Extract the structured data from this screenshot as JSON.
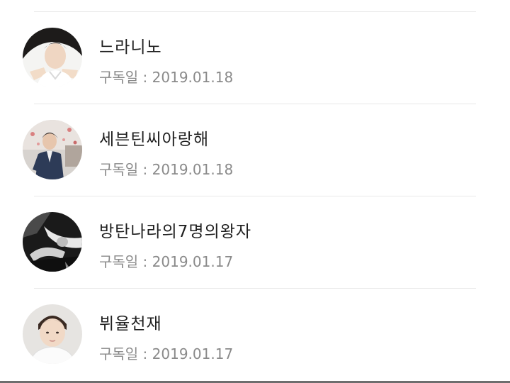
{
  "subscriptions": [
    {
      "name": "느라니노",
      "date_label": "구독일 : 2019.01.18",
      "avatar_icon": "avatar-photo-person-hands"
    },
    {
      "name": "세븐틴씨아랑해",
      "date_label": "구독일 : 2019.01.18",
      "avatar_icon": "avatar-photo-person-suit"
    },
    {
      "name": "방탄나라의7명의왕자",
      "date_label": "구독일 : 2019.01.17",
      "avatar_icon": "avatar-photo-monochrome"
    },
    {
      "name": "뷔율천재",
      "date_label": "구독일 : 2019.01.17",
      "avatar_icon": "avatar-photo-person-white-shirt"
    }
  ],
  "colors": {
    "name_text": "#1f1f1f",
    "meta_text": "#8a8a8a",
    "divider": "#e8e8e8",
    "background": "#ffffff"
  }
}
